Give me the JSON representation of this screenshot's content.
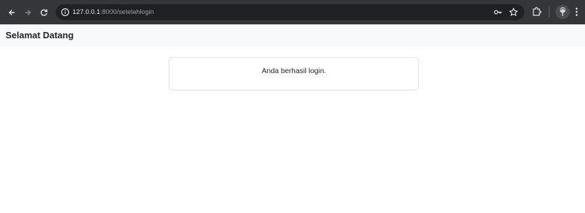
{
  "browser": {
    "back_icon": "arrow-left-icon",
    "forward_icon": "arrow-right-icon",
    "reload_icon": "reload-icon",
    "address": {
      "info_icon": "info-icon",
      "host": "127.0.0.1",
      "rest": ":8000/setelahlogin"
    },
    "password_icon": "key-icon",
    "bookmark_icon": "star-icon",
    "extensions_icon": "puzzle-icon",
    "menu_icon": "kebab-menu-icon"
  },
  "navbar": {
    "brand": "Selamat Datang"
  },
  "card": {
    "message": "Anda berhasil login."
  },
  "colors": {
    "browser_chrome": "#35363a",
    "omnibox": "#202124",
    "navbar_bg": "#f8f9fa",
    "card_border": "#dee2e6",
    "text": "#212529"
  }
}
